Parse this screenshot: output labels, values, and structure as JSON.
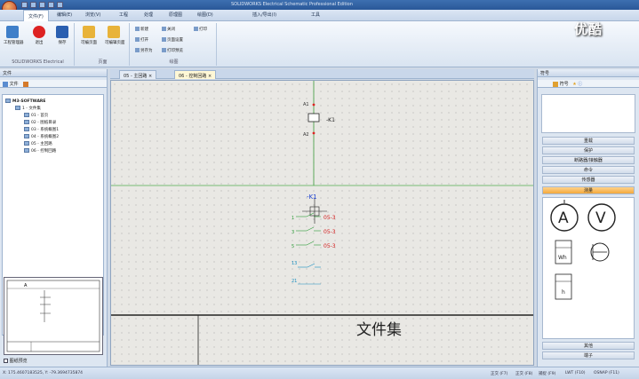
{
  "window": {
    "title": "SOLIDWORKS Electrical Schematic Professional Edition"
  },
  "menu_tabs": [
    "文件(F)",
    "编辑(E)",
    "浏览(V)",
    "工程",
    "处理",
    "原理图",
    "绘图(D)",
    "插入/导出(I)",
    "工具"
  ],
  "ribbon": {
    "group1": {
      "buttons": [
        "工程管理器",
        "退出",
        "保存"
      ],
      "label": "SOLIDWORKS Electrical"
    },
    "group2": {
      "buttons": [
        "可编页面",
        "可编辑页面"
      ],
      "label": "页面"
    },
    "group3": {
      "buttons": [
        "新建",
        "打开",
        "另存为",
        "关闭",
        "页面设置",
        "打印预览",
        "打印"
      ],
      "label": "绘图"
    }
  },
  "left_panel": {
    "title": "文件",
    "tab_label": "文件",
    "tree": [
      "M3-SOFTWARE",
      "1 - 文件集",
      "01 - 首页",
      "02 - 图纸目录",
      "03 - 系统概图1",
      "04 - 系统概图2",
      "05 - 主回路",
      "06 - 控制回路"
    ],
    "checkbox_label": "图纸预览"
  },
  "doc_tabs": [
    "05 - 主回路",
    "06 - 控制回路"
  ],
  "canvas": {
    "coil_label": "-K1",
    "coil_pins": [
      "A1",
      "A2"
    ],
    "contact_header": "-K1",
    "contacts": [
      {
        "pin": "1",
        "ref": "05-3"
      },
      {
        "pin": "3",
        "ref": "05-3"
      },
      {
        "pin": "5",
        "ref": "05-3"
      },
      {
        "pin": "13",
        "ref": ""
      },
      {
        "pin": "21",
        "ref": ""
      }
    ],
    "title_text": "文件集"
  },
  "right_panel": {
    "title": "符号",
    "tab_label": "符号",
    "categories": [
      "重载",
      "保护",
      "断路器/接触器",
      "命令",
      "传感器",
      "测量"
    ],
    "selected": "测量",
    "symbols": {
      "ammeter": "A",
      "voltmeter": "V",
      "energy": "Wh",
      "hours": "h"
    },
    "bottom_categories": [
      "其他",
      "端子"
    ]
  },
  "status": {
    "coords": "X: 175.4607183525, Y: -79.3694735874",
    "items": [
      "正交 (F7)",
      "正交 (F8)",
      "捕捉 (F9)",
      "LWT (F10)",
      "OSNAP (F11)"
    ]
  },
  "watermark": "优酷",
  "colors": {
    "accent": "#2a5899",
    "contact": "#2e9b3a",
    "ref": "#d42020",
    "wire": "#1a8fc0"
  }
}
